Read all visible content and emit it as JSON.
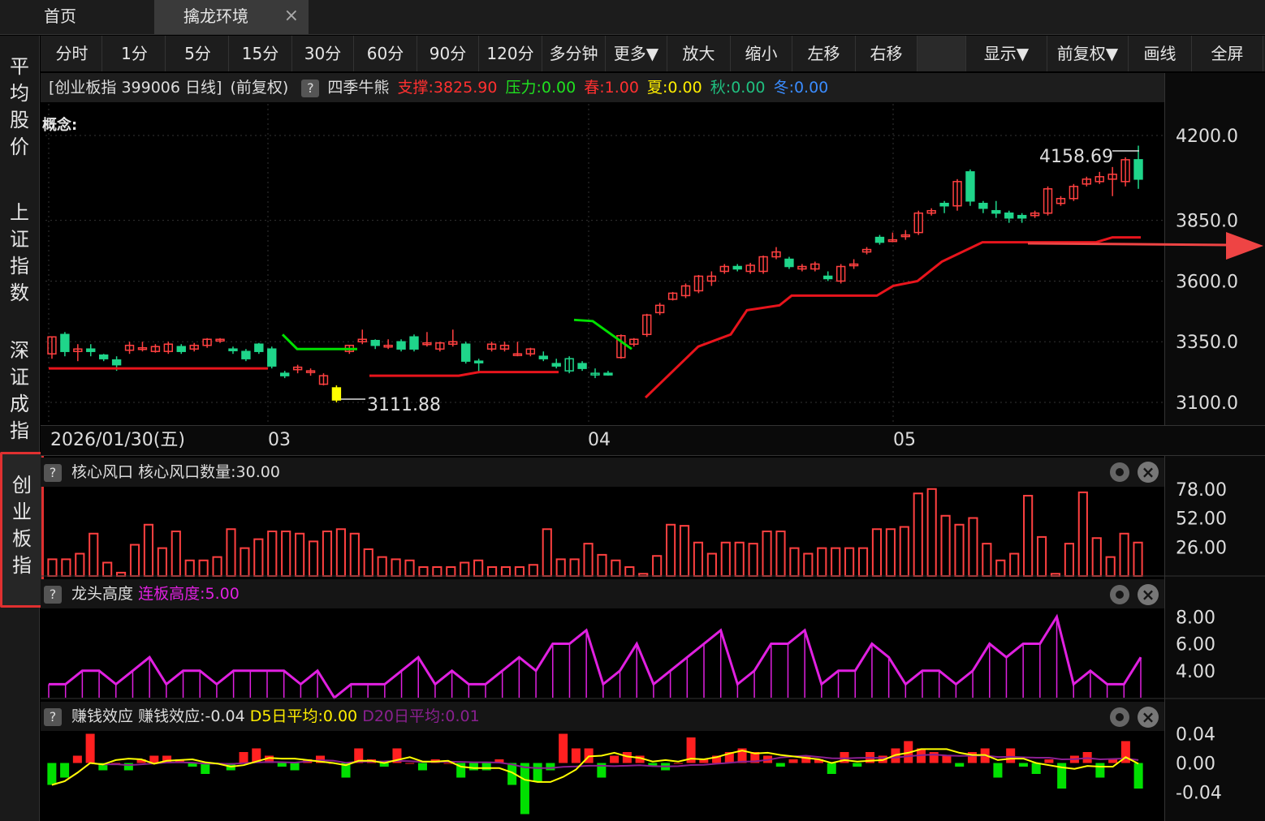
{
  "tabs": {
    "home": "首页",
    "active": "擒龙环境",
    "close": "×"
  },
  "sidebar": {
    "items": [
      {
        "label": "平均股价"
      },
      {
        "label": "上证指数"
      },
      {
        "label": "深证成指"
      },
      {
        "label": "创业板指",
        "selected": true
      }
    ]
  },
  "toolbar": {
    "periods": [
      "分时",
      "1分",
      "5分",
      "15分",
      "30分",
      "60分",
      "90分",
      "120分",
      "多分钟",
      "更多▼"
    ],
    "actions": [
      "放大",
      "缩小",
      "左移",
      "右移"
    ],
    "right": [
      "显示▼",
      "前复权▼",
      "画线",
      "全屏"
    ]
  },
  "info": {
    "symbol": "[创业板指 399006 日线]",
    "adjust": "(前复权)",
    "indicator": "四季牛熊",
    "support": "支撑:3825.90",
    "pressure": "压力:0.00",
    "spring": "春:1.00",
    "summer": "夏:0.00",
    "autumn": "秋:0.00",
    "winter": "冬:0.00",
    "concept": "概念:"
  },
  "colors": {
    "up": "#ff4040",
    "down": "#1fd58a",
    "support": "#e8141c",
    "green": "#00e000",
    "yellow": "#ffff00",
    "magenta": "#e020e0",
    "purple": "#8a2090",
    "red_text": "#ff3030",
    "green_text": "#20e020",
    "yellow_text": "#ffee00",
    "teal_text": "#20c080",
    "blue_text": "#3a8cff"
  },
  "dates": {
    "first": "2026/01/30(五)",
    "m03": "03",
    "m04": "04",
    "m05": "05"
  },
  "labels": {
    "high": "4158.69",
    "low": "3111.88"
  },
  "panels": {
    "core": {
      "title": "核心风口",
      "value": "核心风口数量:30.00"
    },
    "dragon": {
      "title": "龙头高度",
      "value": "连板高度:5.00"
    },
    "money": {
      "title": "赚钱效应",
      "value": "赚钱效应:-0.04",
      "d5": "D5日平均:0.00",
      "d20": "D20日平均:0.01"
    }
  },
  "chart_data": [
    {
      "type": "candlestick",
      "title": "创业板指 399006 日线",
      "yticks": [
        "4200.0",
        "3850.0",
        "3600.0",
        "3350.0",
        "3100.0"
      ],
      "ylim": [
        3080,
        4230
      ],
      "candles": [
        [
          3300,
          3370,
          3280,
          3370
        ],
        [
          3380,
          3310,
          3290,
          3390
        ],
        [
          3310,
          3320,
          3270,
          3340
        ],
        [
          3320,
          3310,
          3290,
          3340
        ],
        [
          3295,
          3280,
          3270,
          3300
        ],
        [
          3275,
          3255,
          3230,
          3290
        ],
        [
          3315,
          3335,
          3300,
          3350
        ],
        [
          3325,
          3325,
          3310,
          3350
        ],
        [
          3310,
          3330,
          3305,
          3340
        ],
        [
          3310,
          3340,
          3300,
          3350
        ],
        [
          3330,
          3310,
          3300,
          3340
        ],
        [
          3320,
          3335,
          3310,
          3345
        ],
        [
          3335,
          3360,
          3325,
          3365
        ],
        [
          3355,
          3360,
          3345,
          3365
        ],
        [
          3320,
          3315,
          3300,
          3330
        ],
        [
          3310,
          3280,
          3270,
          3320
        ],
        [
          3340,
          3310,
          3300,
          3345
        ],
        [
          3320,
          3250,
          3240,
          3330
        ],
        [
          3220,
          3210,
          3200,
          3230
        ],
        [
          3235,
          3245,
          3220,
          3255
        ],
        [
          3225,
          3230,
          3210,
          3240
        ],
        [
          3175,
          3210,
          3170,
          3220
        ],
        [
          3160,
          3110,
          3100,
          3170
        ],
        [
          3310,
          3335,
          3300,
          3335
        ],
        [
          3350,
          3360,
          3340,
          3400
        ],
        [
          3355,
          3335,
          3320,
          3360
        ],
        [
          3330,
          3335,
          3320,
          3360
        ],
        [
          3350,
          3320,
          3310,
          3360
        ],
        [
          3370,
          3320,
          3310,
          3380
        ],
        [
          3345,
          3345,
          3330,
          3390
        ],
        [
          3320,
          3345,
          3310,
          3350
        ],
        [
          3340,
          3350,
          3330,
          3400
        ],
        [
          3340,
          3270,
          3260,
          3350
        ],
        [
          3270,
          3265,
          3220,
          3280
        ],
        [
          3320,
          3340,
          3310,
          3350
        ],
        [
          3320,
          3335,
          3310,
          3350
        ],
        [
          3300,
          3300,
          3290,
          3350
        ],
        [
          3300,
          3320,
          3290,
          3325
        ],
        [
          3290,
          3280,
          3270,
          3310
        ],
        [
          3260,
          3250,
          3240,
          3280
        ],
        [
          3230,
          3280,
          3220,
          3290
        ],
        [
          3260,
          3240,
          3230,
          3270
        ],
        [
          3220,
          3220,
          3200,
          3240
        ],
        [
          3220,
          3215,
          3210,
          3230
        ],
        [
          3285,
          3375,
          3280,
          3380
        ],
        [
          3340,
          3360,
          3330,
          3365
        ],
        [
          3380,
          3460,
          3370,
          3465
        ],
        [
          3470,
          3500,
          3460,
          3510
        ],
        [
          3525,
          3550,
          3520,
          3555
        ],
        [
          3540,
          3580,
          3530,
          3590
        ],
        [
          3560,
          3620,
          3550,
          3625
        ],
        [
          3600,
          3620,
          3580,
          3640
        ],
        [
          3640,
          3660,
          3630,
          3670
        ],
        [
          3660,
          3650,
          3640,
          3670
        ],
        [
          3640,
          3665,
          3630,
          3675
        ],
        [
          3640,
          3700,
          3630,
          3705
        ],
        [
          3700,
          3720,
          3690,
          3740
        ],
        [
          3690,
          3660,
          3650,
          3700
        ],
        [
          3650,
          3660,
          3640,
          3670
        ],
        [
          3650,
          3670,
          3640,
          3680
        ],
        [
          3620,
          3610,
          3600,
          3640
        ],
        [
          3600,
          3660,
          3590,
          3670
        ],
        [
          3670,
          3670,
          3650,
          3690
        ],
        [
          3720,
          3730,
          3710,
          3740
        ],
        [
          3780,
          3760,
          3750,
          3790
        ],
        [
          3770,
          3770,
          3760,
          3800
        ],
        [
          3790,
          3790,
          3770,
          3810
        ],
        [
          3800,
          3880,
          3790,
          3890
        ],
        [
          3880,
          3890,
          3870,
          3900
        ],
        [
          3920,
          3910,
          3880,
          3930
        ],
        [
          3910,
          4010,
          3890,
          4020
        ],
        [
          4050,
          3930,
          3910,
          4060
        ],
        [
          3920,
          3900,
          3880,
          3930
        ],
        [
          3890,
          3880,
          3860,
          3930
        ],
        [
          3880,
          3860,
          3840,
          3890
        ],
        [
          3870,
          3860,
          3840,
          3880
        ],
        [
          3870,
          3880,
          3860,
          3890
        ],
        [
          3880,
          3980,
          3870,
          3990
        ],
        [
          3920,
          3940,
          3910,
          3950
        ],
        [
          3940,
          3990,
          3930,
          4000
        ],
        [
          4000,
          4020,
          3990,
          4030
        ],
        [
          4010,
          4030,
          4000,
          4050
        ],
        [
          4020,
          4040,
          3950,
          4070
        ],
        [
          4010,
          4100,
          3990,
          4110
        ],
        [
          4100,
          4020,
          3980,
          4158
        ]
      ]
    },
    {
      "type": "bar",
      "title": "核心风口",
      "yticks": [
        "78.00",
        "52.00",
        "26.00"
      ],
      "ylim": [
        0,
        80
      ],
      "values": [
        15,
        15,
        20,
        38,
        12,
        3,
        28,
        46,
        25,
        40,
        14,
        14,
        17,
        42,
        25,
        33,
        40,
        40,
        38,
        31,
        40,
        42,
        38,
        24,
        17,
        15,
        14,
        8,
        8,
        8,
        12,
        14,
        8,
        8,
        8,
        10,
        42,
        15,
        15,
        29,
        19,
        14,
        8,
        2,
        18,
        46,
        45,
        30,
        20,
        30,
        30,
        29,
        40,
        40,
        25,
        20,
        25,
        25,
        25,
        25,
        42,
        42,
        44,
        74,
        78,
        54,
        46,
        52,
        29,
        14,
        20,
        72,
        35,
        2,
        29,
        75,
        34,
        17,
        38,
        30
      ],
      "colors": [
        "#ff4040"
      ]
    },
    {
      "type": "line",
      "title": "龙头高度",
      "yticks": [
        "8.00",
        "6.00",
        "4.00"
      ],
      "ylim": [
        2,
        8.5
      ],
      "values": [
        3,
        3,
        4,
        4,
        3,
        4,
        5,
        3,
        4,
        4,
        3,
        4,
        4,
        4,
        4,
        3,
        4,
        2,
        3,
        3,
        3,
        4,
        5,
        3,
        4,
        3,
        3,
        4,
        5,
        4,
        6,
        6,
        7,
        3,
        4,
        6,
        3,
        4,
        5,
        6,
        7,
        3,
        4,
        6,
        6,
        7,
        3,
        4,
        4,
        6,
        5,
        3,
        4,
        4,
        3,
        4,
        6,
        5,
        6,
        6,
        8,
        3,
        4,
        3,
        3,
        5
      ],
      "colors": [
        "#e020e0"
      ]
    },
    {
      "type": "bar",
      "title": "赚钱效应",
      "yticks": [
        "0.04",
        "0.00",
        "-0.04"
      ],
      "ylim": [
        -0.075,
        0.045
      ],
      "values": [
        -0.03,
        -0.02,
        0.01,
        0.04,
        -0.01,
        0.0,
        -0.01,
        0.005,
        0.01,
        0.01,
        0.005,
        -0.005,
        -0.015,
        0.0,
        -0.01,
        0.015,
        0.02,
        0.01,
        -0.005,
        -0.01,
        0.005,
        0.01,
        0.0,
        -0.02,
        0.02,
        0.005,
        -0.005,
        0.02,
        0.0,
        -0.01,
        0.005,
        0.0,
        -0.02,
        -0.01,
        -0.01,
        0.005,
        -0.03,
        -0.07,
        -0.025,
        -0.01,
        0.04,
        0.02,
        0.02,
        -0.02,
        0.01,
        0.015,
        0.01,
        -0.005,
        -0.01,
        0.0,
        0.035,
        0.005,
        0.01,
        0.015,
        0.02,
        0.015,
        0.01,
        -0.005,
        0.005,
        0.01,
        0.005,
        -0.015,
        0.015,
        -0.005,
        0.015,
        0.01,
        0.02,
        0.03,
        0.02,
        0.015,
        0.01,
        -0.005,
        0.015,
        0.02,
        -0.02,
        0.02,
        -0.005,
        -0.015,
        0.005,
        -0.035,
        0.01,
        0.015,
        -0.02,
        0.005,
        0.03,
        -0.035
      ],
      "colors": [
        "#ff2020",
        "#00e000"
      ]
    }
  ]
}
